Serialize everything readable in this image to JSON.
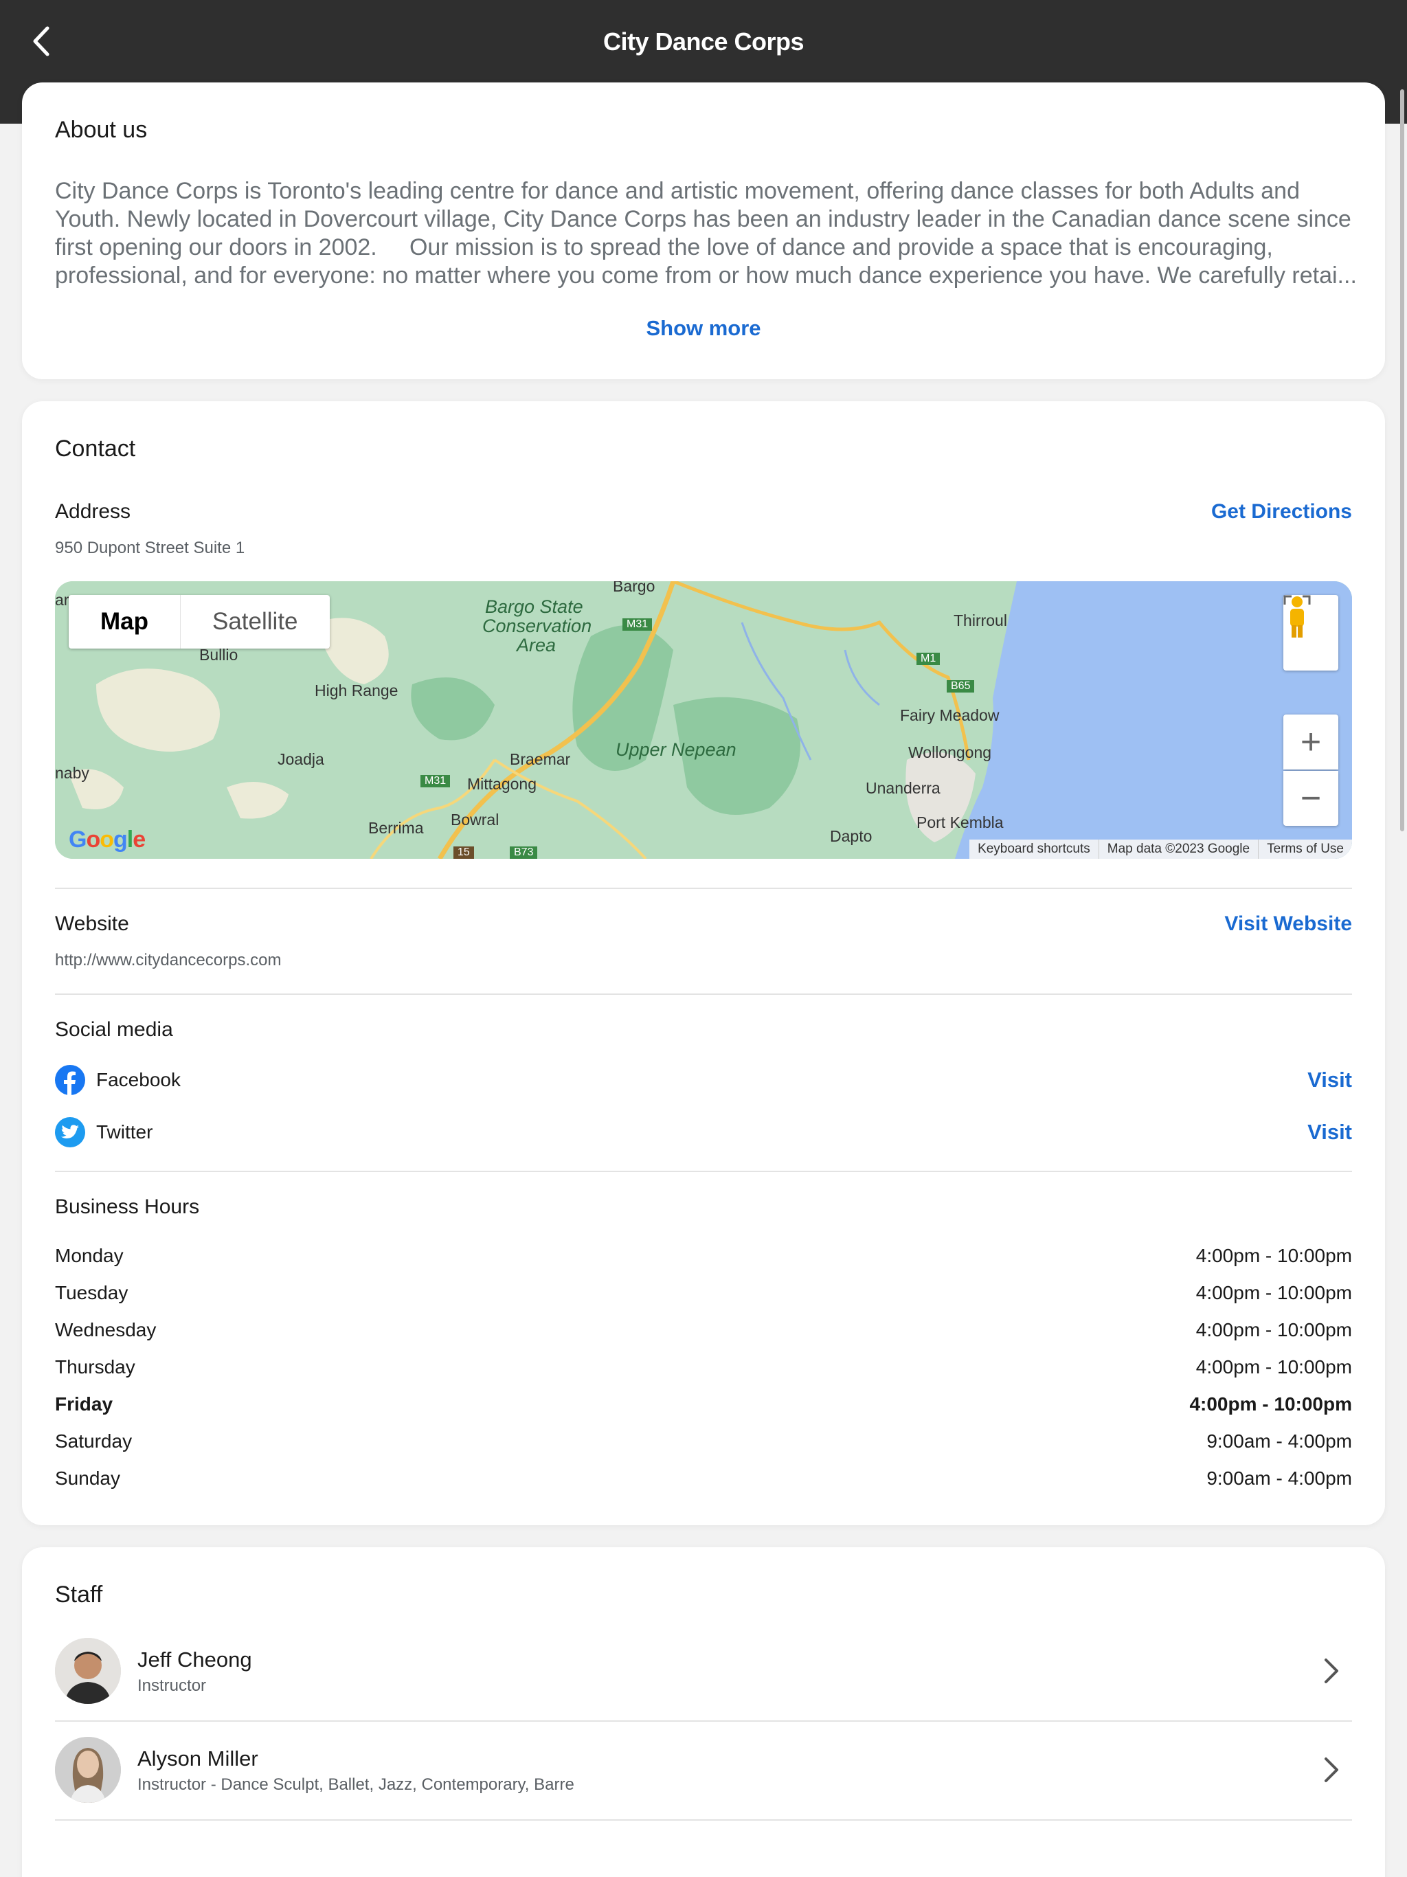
{
  "header": {
    "title": "City Dance Corps"
  },
  "about": {
    "heading": "About us",
    "text": "City Dance Corps is Toronto's leading centre for dance and artistic movement, offering dance classes for both Adults and Youth. Newly located in Dovercourt village, City Dance Corps has been an industry leader in the Canadian dance scene since first opening our doors in 2002.     Our mission is to spread the love of dance and provide a space that is encouraging, professional, and for everyone: no matter where you come from or how much dance experience you have. We carefully retai...",
    "show_more": "Show more"
  },
  "contact": {
    "heading": "Contact",
    "address_label": "Address",
    "address": "950 Dupont Street Suite 1",
    "directions": "Get Directions",
    "map": {
      "type_map": "Map",
      "type_satellite": "Satellite",
      "labels": {
        "bargo": "Bargo",
        "bargo_state": "Bargo State",
        "conservation": "Conservation",
        "area": "Area",
        "thirroul": "Thirroul",
        "bullio": "Bullio",
        "high_range": "High Range",
        "joadja": "Joadja",
        "braemar": "Braemar",
        "upper_nepean": "Upper Nepean",
        "fairy_meadow": "Fairy Meadow",
        "wollongong": "Wollongong",
        "mittagong": "Mittagong",
        "unanderra": "Unanderra",
        "bowral": "Bowral",
        "berrima": "Berrima",
        "port_kembla": "Port Kembla",
        "dapto": "Dapto",
        "naby": "naby",
        "ar": "ar",
        "m31a": "M31",
        "m31b": "M31",
        "m1": "M1",
        "b65": "B65",
        "r15": "15",
        "b73": "B73"
      },
      "google": "Google",
      "keyboard": "Keyboard shortcuts",
      "mapdata": "Map data ©2023 Google",
      "terms": "Terms of Use",
      "zoom_in": "+",
      "zoom_out": "−"
    },
    "website_label": "Website",
    "website": "http://www.citydancecorps.com",
    "visit_website": "Visit Website",
    "social_label": "Social media",
    "social": [
      {
        "name": "Facebook",
        "visit": "Visit",
        "icon": "facebook-icon",
        "color": "#1877f2"
      },
      {
        "name": "Twitter",
        "visit": "Visit",
        "icon": "twitter-icon",
        "color": "#1d9bf0"
      }
    ],
    "hours_label": "Business Hours",
    "hours": [
      {
        "day": "Monday",
        "time": "4:00pm - 10:00pm"
      },
      {
        "day": "Tuesday",
        "time": "4:00pm - 10:00pm"
      },
      {
        "day": "Wednesday",
        "time": "4:00pm - 10:00pm"
      },
      {
        "day": "Thursday",
        "time": "4:00pm - 10:00pm"
      },
      {
        "day": "Friday",
        "time": "4:00pm - 10:00pm"
      },
      {
        "day": "Saturday",
        "time": "9:00am - 4:00pm"
      },
      {
        "day": "Sunday",
        "time": "9:00am - 4:00pm"
      }
    ]
  },
  "staff": {
    "heading": "Staff",
    "members": [
      {
        "name": "Jeff Cheong",
        "role": "Instructor"
      },
      {
        "name": "Alyson Miller",
        "role": "Instructor - Dance Sculpt, Ballet, Jazz, Contemporary, Barre"
      }
    ]
  },
  "colors": {
    "header_bg": "#2f2f2f",
    "link": "#1a6ad1",
    "water": "#9ec0f3",
    "land": "#b7dcc0"
  }
}
